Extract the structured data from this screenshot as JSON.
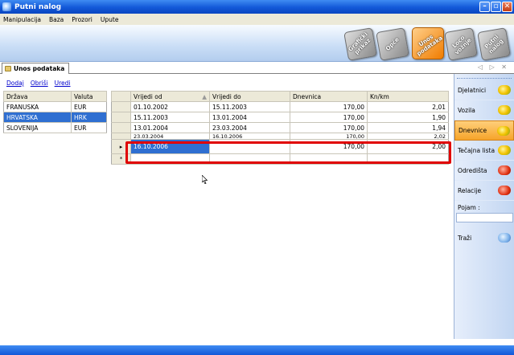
{
  "window": {
    "title": "Putni nalog"
  },
  "menu": [
    "Manipulacija",
    "Baza",
    "Prozori",
    "Upute"
  ],
  "toolbar": {
    "buttons": [
      "Grafički prikaz",
      "Opće",
      "Unos podataka",
      "Loco vožnje",
      "Putni nalog"
    ],
    "active_index": 2
  },
  "tab": {
    "label": "Unos podataka",
    "controls": "◁ ▷ ✕"
  },
  "actions": [
    "Dodaj",
    "Obriši",
    "Uredi"
  ],
  "countries": {
    "headers": [
      "Država",
      "Valuta"
    ],
    "rows": [
      [
        "FRANUSKA",
        "EUR"
      ],
      [
        "HRVATSKA",
        "HRK"
      ],
      [
        "SLOVENIJA",
        "EUR"
      ]
    ],
    "selected_index": 1
  },
  "rates": {
    "headers": [
      "Vrijedi od",
      "Vrijedi do",
      "Dnevnica",
      "Kn/km"
    ],
    "rows": [
      [
        "01.10.2002",
        "15.11.2003",
        "170,00",
        "2,01"
      ],
      [
        "15.11.2003",
        "13.01.2004",
        "170,00",
        "1,90"
      ],
      [
        "13.01.2004",
        "23.03.2004",
        "170,00",
        "1,94"
      ],
      [
        "23.03.2004",
        "16.10.2006",
        "170,00",
        "2,02"
      ]
    ],
    "current_row": [
      "16.10.2006",
      "",
      "170,00",
      "2,00"
    ],
    "current_marker": "▸",
    "new_marker": "*"
  },
  "sidebar": {
    "items": [
      {
        "label": "Djelatnici",
        "icon": "people-icon"
      },
      {
        "label": "Vozila",
        "icon": "car-icon"
      },
      {
        "label": "Dnevnice",
        "icon": "allowance-icon"
      },
      {
        "label": "Tečajna lista",
        "icon": "exchange-icon"
      },
      {
        "label": "Odredišta",
        "icon": "destination-icon"
      },
      {
        "label": "Relacije",
        "icon": "route-icon"
      }
    ],
    "active_index": 2,
    "search_label": "Pojam :",
    "search_value": "",
    "search_button": "Traži"
  },
  "colors": {
    "selection": "#2f6fd1",
    "highlight": "#e00000",
    "active_button": "#f6a42a"
  }
}
